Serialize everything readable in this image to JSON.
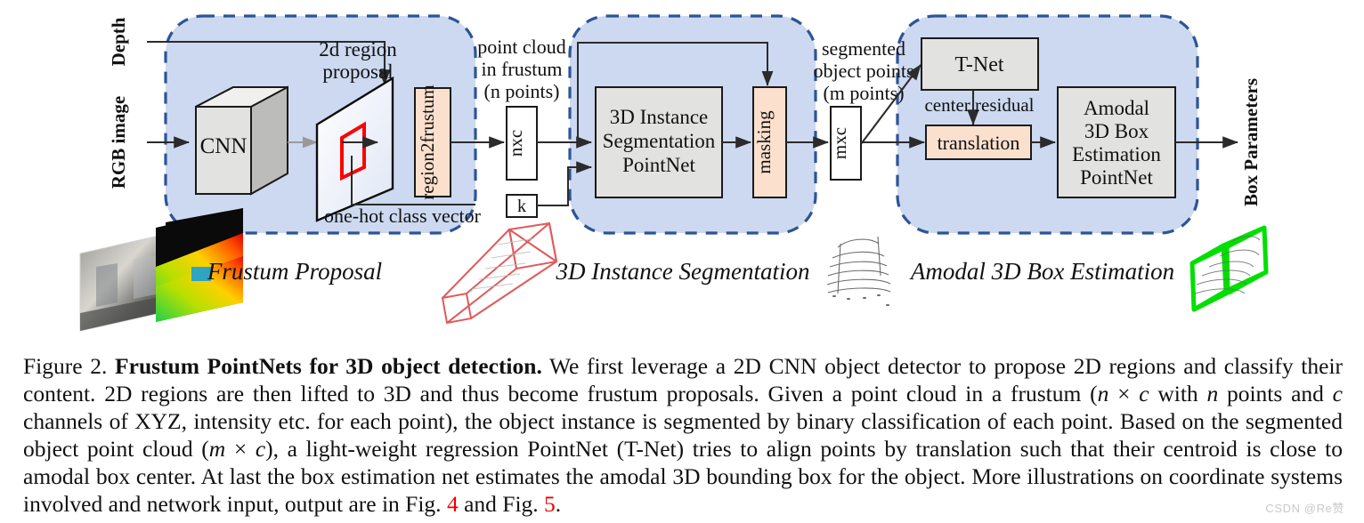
{
  "figure": {
    "io_labels": {
      "depth": "Depth",
      "rgb_image": "RGB image",
      "box_parameters": "Box Parameters"
    },
    "panels": [
      {
        "id": "frustum-proposal",
        "stage_label": "Frustum Proposal"
      },
      {
        "id": "instance-segmentation",
        "stage_label": "3D Instance Segmentation"
      },
      {
        "id": "box-estimation",
        "stage_label": "Amodal 3D Box Estimation"
      }
    ],
    "blocks": {
      "cnn": "CNN",
      "region2frustum": "region2frustum",
      "nxc": "nxc",
      "k": "k",
      "seg_pointnet_line1": "3D Instance",
      "seg_pointnet_line2": "Segmentation",
      "seg_pointnet_line3": "PointNet",
      "masking": "masking",
      "mxc": "mxc",
      "tnet": "T-Net",
      "translation": "translation",
      "amodal_line1": "Amodal",
      "amodal_line2": "3D Box",
      "amodal_line3": "Estimation",
      "amodal_line4": "PointNet"
    },
    "edge_labels": {
      "region_proposal_line1": "2d region",
      "region_proposal_line2": "proposal",
      "one_hot": "one-hot class vector",
      "point_cloud_line1": "point cloud",
      "point_cloud_line2": "in frustum",
      "point_cloud_line3": "(n points)",
      "segmented_line1": "segmented",
      "segmented_line2": "object points",
      "segmented_line3": "(m points)",
      "center_residual": "center residual"
    },
    "colors": {
      "panel_fill": "#ccd9f0",
      "panel_stroke": "#2e5496",
      "grey_block": "#e2e2e0",
      "peach_block": "#fbe0cd",
      "white_block": "#ffffff",
      "stroke": "#2b2b2b",
      "red_accent": "#ff0000",
      "green_box": "#00e000",
      "frustum_red": "#e05a5a"
    }
  },
  "caption": {
    "figure_number": "Figure 2.",
    "title": "Frustum PointNets for 3D object detection.",
    "body_1": " We first leverage a 2D CNN object detector to propose 2D regions and classify their content. 2D regions are then lifted to 3D and thus become frustum proposals. Given a point cloud in a frustum (",
    "math_n": "n",
    "times_1": " × ",
    "math_c": "c",
    "body_2": " with ",
    "math_n2": "n",
    "body_3": " points and ",
    "math_c2": "c",
    "body_4": " channels of XYZ, intensity etc. for each point), the object instance is segmented by binary classification of each point. Based on the segmented object point cloud (",
    "math_m": "m",
    "times_2": " × ",
    "math_c3": "c",
    "body_5": "), a light-weight regression PointNet (T-Net) tries to align points by translation such that their centroid is close to amodal box center. At last the box estimation net estimates the amodal 3D bounding box for the object. More illustrations on coordinate systems involved and network input, output are in Fig. ",
    "ref_4": "4",
    "body_6": " and Fig. ",
    "ref_5": "5",
    "body_7": "."
  },
  "watermark": {
    "text": "CSDN @Re赞"
  }
}
